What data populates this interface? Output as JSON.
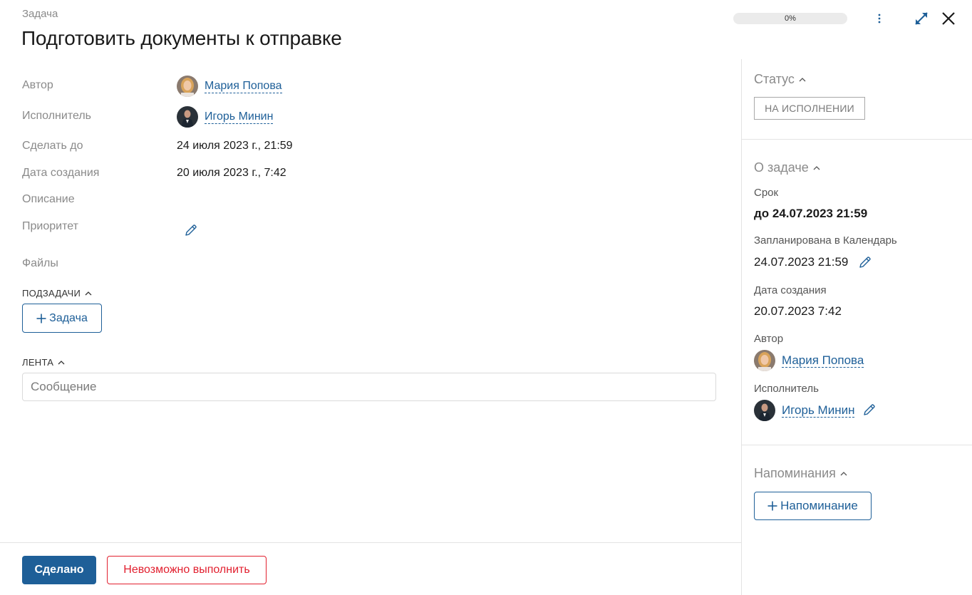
{
  "header": {
    "caption": "Задача",
    "title": "Подготовить документы к отправке",
    "progress": "0%"
  },
  "fields": {
    "author_label": "Автор",
    "author_name": "Мария Попова",
    "executor_label": "Исполнитель",
    "executor_name": "Игорь Минин",
    "due_label": "Сделать до",
    "due_value": "24 июля 2023 г., 21:59",
    "created_label": "Дата создания",
    "created_value": "20 июля 2023 г., 7:42",
    "description_label": "Описание",
    "priority_label": "Приоритет",
    "files_label": "Файлы"
  },
  "subtasks": {
    "caption": "ПОДЗАДАЧИ",
    "add_label": "Задача"
  },
  "feed": {
    "caption": "ЛЕНТА",
    "placeholder": "Сообщение"
  },
  "footer": {
    "done_label": "Сделано",
    "cannot_label": "Невозможно выполнить"
  },
  "sidebar": {
    "status_head": "Статус",
    "status_value": "НА ИСПОЛНЕНИИ",
    "about_head": "О задаче",
    "deadline_label": "Срок",
    "deadline_value": "до 24.07.2023 21:59",
    "calendar_label": "Запланирована в Календарь",
    "calendar_value": "24.07.2023 21:59",
    "created_label": "Дата создания",
    "created_value": "20.07.2023 7:42",
    "author_label": "Автор",
    "author_name": "Мария Попова",
    "executor_label": "Исполнитель",
    "executor_name": "Игорь Минин",
    "reminders_head": "Напоминания",
    "add_reminder_label": "Напоминание"
  },
  "colors": {
    "accent": "#1e5f98",
    "danger": "#e2202f",
    "muted": "#8a8a8a"
  },
  "icons": [
    "more-vertical-icon",
    "expand-icon",
    "close-icon",
    "pencil-icon",
    "chevron-up-icon",
    "plus-icon"
  ]
}
